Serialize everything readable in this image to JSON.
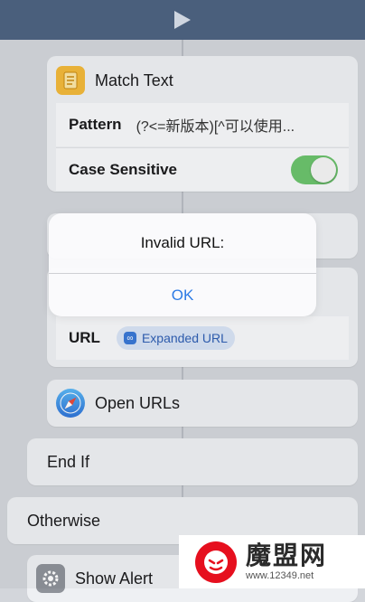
{
  "blocks": {
    "match_text": {
      "title": "Match Text",
      "pattern_label": "Pattern",
      "pattern_value": "(?<=新版本)[^可以使用...",
      "case_label": "Case Sensitive",
      "case_on": true
    },
    "url_block": {
      "url_label": "URL",
      "token": "Expanded URL"
    },
    "open_urls": {
      "title": "Open URLs"
    },
    "end_if": {
      "title": "End If"
    },
    "otherwise": {
      "title": "Otherwise"
    },
    "show_alert": {
      "title": "Show Alert"
    }
  },
  "alert": {
    "title": "Invalid URL:",
    "ok_label": "OK"
  },
  "icons": {
    "match_text": "document-icon",
    "open_urls": "safari-compass-icon",
    "show_alert": "gear-icon",
    "token": "link-icon",
    "run": "play-icon"
  },
  "colors": {
    "topbar": "#4a5f7c",
    "toggle_on": "#6cc36d",
    "alert_button": "#2d7be5"
  },
  "watermark": {
    "name": "魔盟网",
    "url": "www.12349.net"
  }
}
